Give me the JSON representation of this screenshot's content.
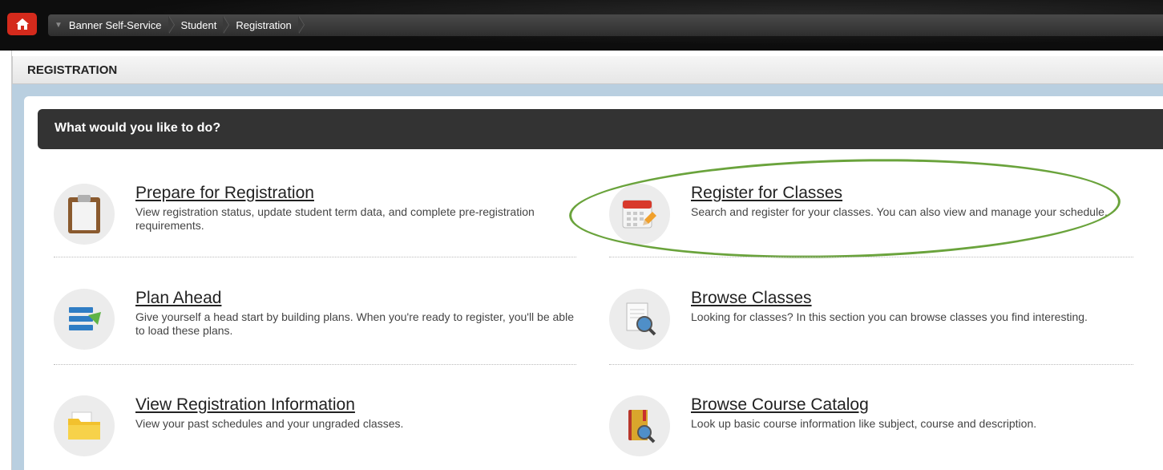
{
  "breadcrumb": {
    "items": [
      "Banner Self-Service",
      "Student",
      "Registration"
    ]
  },
  "page": {
    "title": "REGISTRATION",
    "prompt": "What would you like to do?"
  },
  "options": {
    "prepare": {
      "title": "Prepare for Registration",
      "desc": "View registration status, update student term data, and complete pre-registration requirements.",
      "icon": "clipboard-icon"
    },
    "register": {
      "title": "Register for Classes",
      "desc": "Search and register for your classes. You can also view and manage your schedule.",
      "icon": "calendar-pencil-icon"
    },
    "plan": {
      "title": "Plan Ahead",
      "desc": "Give yourself a head start by building plans. When you're ready to register, you'll be able to load these plans.",
      "icon": "list-arrow-icon"
    },
    "browse_classes": {
      "title": "Browse Classes",
      "desc": "Looking for classes? In this section you can browse classes you find interesting.",
      "icon": "document-magnifier-icon"
    },
    "view_info": {
      "title": "View Registration Information",
      "desc": "View your past schedules and your ungraded classes.",
      "icon": "folder-icon"
    },
    "catalog": {
      "title": "Browse Course Catalog",
      "desc": "Look up basic course information like subject, course and description.",
      "icon": "book-magnifier-icon"
    }
  },
  "colors": {
    "accent": "#d42a1c",
    "highlight": "#6aa33c",
    "header_dark": "#333333"
  }
}
